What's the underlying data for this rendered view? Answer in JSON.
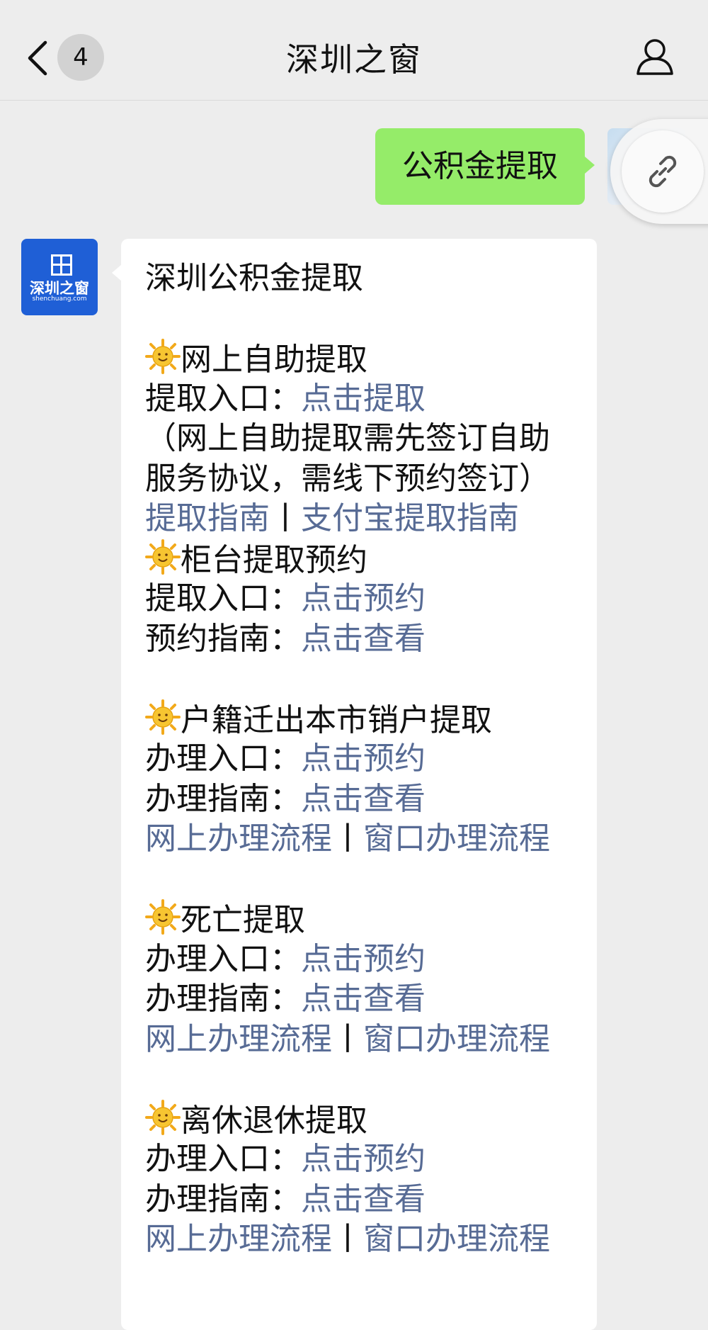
{
  "header": {
    "title": "深圳之窗",
    "unread_count": "4"
  },
  "outgoing": {
    "message": "公积金提取"
  },
  "sender": {
    "logo_cn": "深圳之窗",
    "logo_en": "shenchuang.com"
  },
  "incoming": {
    "title": "深圳公积金提取",
    "s1_heading": "网上自助提取",
    "s1_entry_label": "提取入口：",
    "s1_entry_link": "点击提取",
    "s1_note_1": "（网上自助提取需先签订自助",
    "s1_note_2": "服务协议，需线下预约签订）",
    "s1_guide_link": "提取指南",
    "separator": "丨",
    "s1_alipay_link": "支付宝提取指南",
    "s2_heading": "柜台提取预约",
    "s2_entry_label": "提取入口：",
    "s2_entry_link": "点击预约",
    "s2_guide_label": "预约指南：",
    "s2_guide_link": "点击查看",
    "s3_heading": "户籍迁出本市销户提取",
    "s3_entry_label": "办理入口：",
    "s3_entry_link": "点击预约",
    "s3_guide_label": "办理指南：",
    "s3_guide_link": "点击查看",
    "s3_online_link": "网上办理流程",
    "s3_window_link": "窗口办理流程",
    "s4_heading": "死亡提取",
    "s4_entry_label": "办理入口：",
    "s4_entry_link": "点击预约",
    "s4_guide_label": "办理指南：",
    "s4_guide_link": "点击查看",
    "s4_online_link": "网上办理流程",
    "s4_window_link": "窗口办理流程",
    "s5_heading": "离休退休提取",
    "s5_entry_label": "办理入口：",
    "s5_entry_link": "点击预约",
    "s5_guide_label": "办理指南：",
    "s5_guide_link": "点击查看",
    "s5_online_link": "网上办理流程",
    "s5_window_link": "窗口办理流程"
  },
  "colors": {
    "link": "#576b95",
    "outgoing_bubble": "#95ec69",
    "background": "#ededed"
  },
  "icons": [
    "chevron-left-icon",
    "user-icon",
    "link-icon",
    "sun-emoji-icon"
  ]
}
